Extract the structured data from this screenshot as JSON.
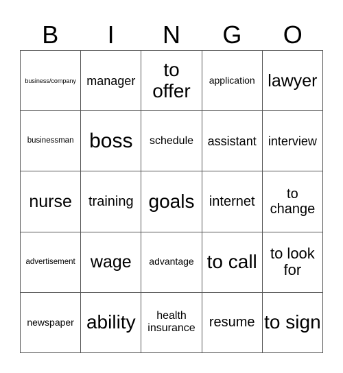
{
  "header": [
    "B",
    "I",
    "N",
    "G",
    "O"
  ],
  "cells": [
    "business/company",
    "manager",
    "to offer",
    "application",
    "lawyer",
    "businessman",
    "boss",
    "schedule",
    "assistant",
    "interview",
    "nurse",
    "training",
    "goals",
    "internet",
    "to change",
    "advertisement",
    "wage",
    "advantage",
    "to call",
    "to look for",
    "newspaper",
    "ability",
    "health insurance",
    "resume",
    "to sign"
  ]
}
